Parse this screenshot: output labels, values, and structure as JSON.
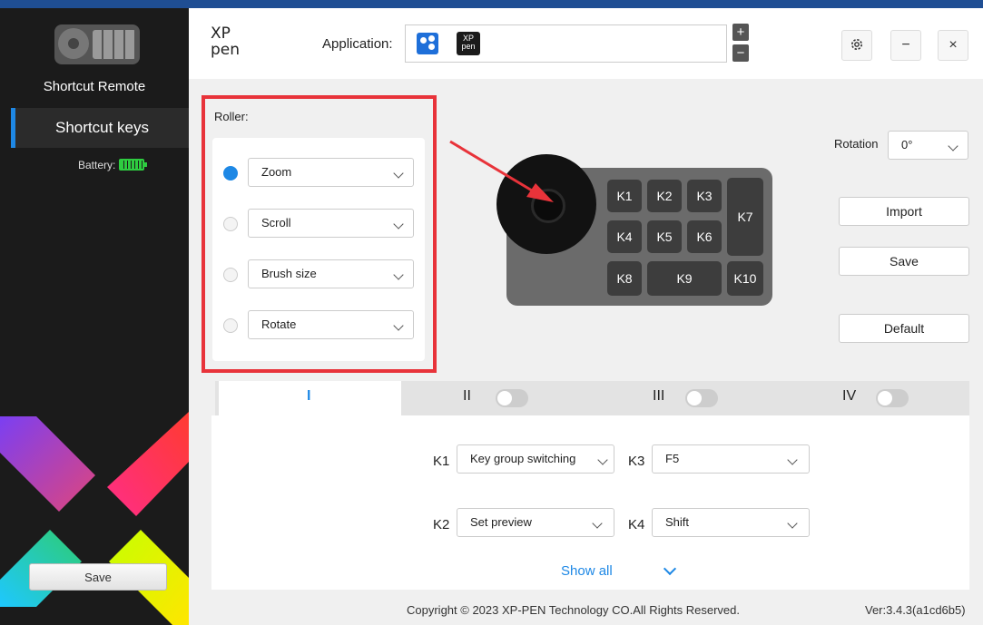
{
  "sidebar": {
    "device_name": "Shortcut Remote",
    "nav_item": "Shortcut keys",
    "battery_label": "Battery:",
    "save_label": "Save"
  },
  "header": {
    "logo_text": "XP pen",
    "application_label": "Application:",
    "add_label": "+",
    "remove_label": "−",
    "settings_icon": "gear-icon",
    "minimize_label": "−",
    "close_label": "×"
  },
  "roller": {
    "title": "Roller:",
    "options": [
      {
        "value": "Zoom",
        "selected": true
      },
      {
        "value": "Scroll",
        "selected": false
      },
      {
        "value": "Brush size",
        "selected": false
      },
      {
        "value": "Rotate",
        "selected": false
      }
    ]
  },
  "device": {
    "keys": [
      "K1",
      "K2",
      "K3",
      "K4",
      "K5",
      "K6",
      "K7",
      "K8",
      "K9",
      "K10"
    ],
    "logo": "XP pen"
  },
  "right_panel": {
    "rotation_label": "Rotation",
    "rotation_value": "0°",
    "import_label": "Import",
    "save_label": "Save",
    "default_label": "Default"
  },
  "tabs": [
    {
      "label": "I",
      "active": true
    },
    {
      "label": "II",
      "enabled": false
    },
    {
      "label": "III",
      "enabled": false
    },
    {
      "label": "IV",
      "enabled": false
    }
  ],
  "key_assignments": [
    {
      "key": "K1",
      "value": "Key group switching"
    },
    {
      "key": "K3",
      "value": "F5"
    },
    {
      "key": "K2",
      "value": "Set preview"
    },
    {
      "key": "K4",
      "value": "Shift"
    }
  ],
  "show_all_label": "Show all",
  "footer": {
    "copyright": "Copyright © 2023  XP-PEN Technology CO.All Rights Reserved.",
    "version": "Ver:3.4.3(a1cd6b5)"
  },
  "colors": {
    "accent": "#1e88e5",
    "highlight_outline": "#e8333a",
    "sidebar_bg": "#1b1b1b",
    "battery": "#2ecc40"
  }
}
